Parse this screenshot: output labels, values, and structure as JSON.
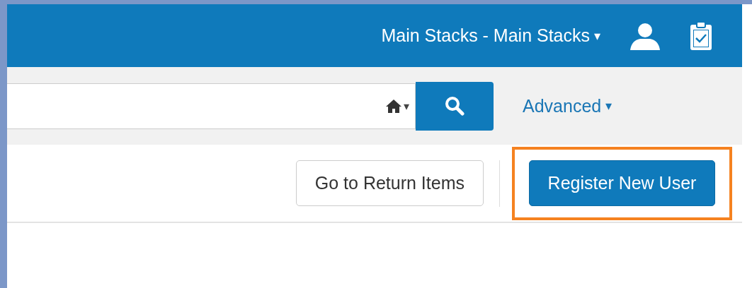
{
  "header": {
    "location": "Main Stacks - Main Stacks",
    "location_caret": "▾"
  },
  "search": {
    "scope_caret": "▾",
    "advanced": "Advanced",
    "advanced_caret": "▾"
  },
  "actions": [
    {
      "label": "Go to Return Items",
      "kind": "secondary",
      "highlighted": false
    },
    {
      "label": "Register New User",
      "kind": "primary",
      "highlighted": true
    }
  ]
}
